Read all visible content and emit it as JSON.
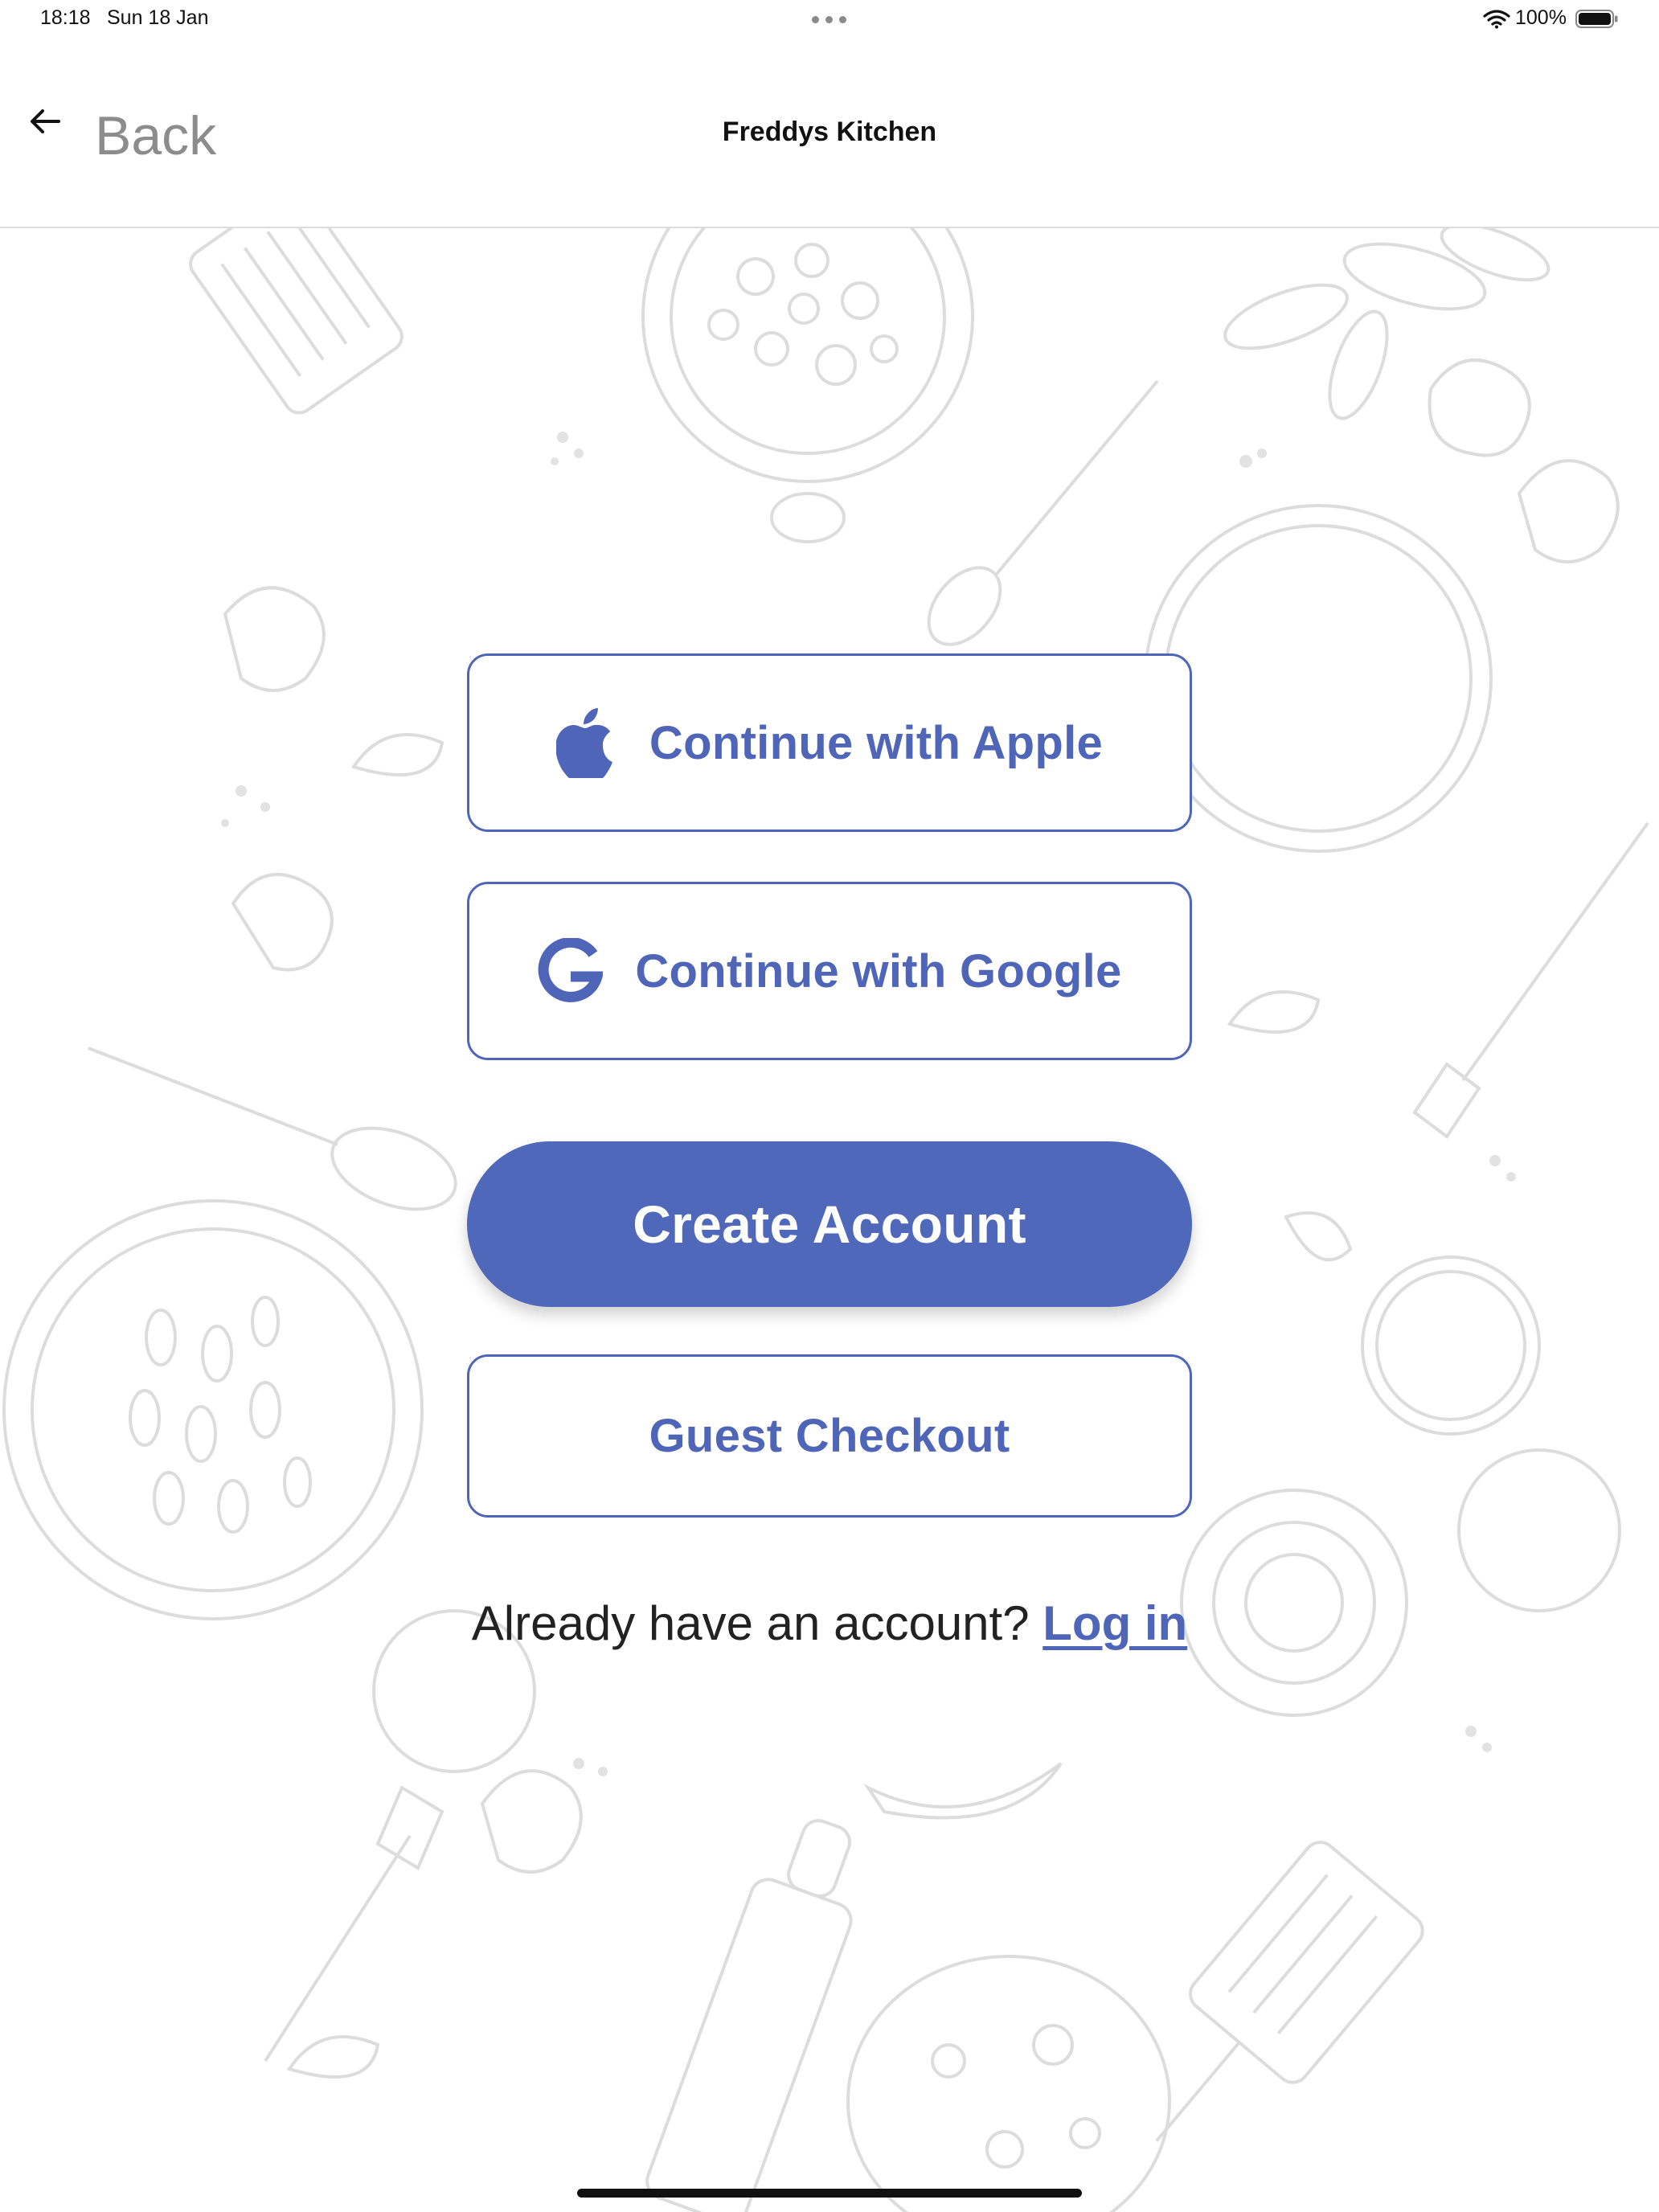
{
  "status_bar": {
    "time": "18:18",
    "date": "Sun 18 Jan",
    "battery_percent": "100%",
    "battery_level": 1.0,
    "icons": [
      "multitasking-dots-icon",
      "wifi-icon",
      "battery-icon"
    ]
  },
  "nav": {
    "back_label": "Back",
    "back_icon": "back-arrow-icon",
    "title": "Freddys Kitchen"
  },
  "auth": {
    "apple_label": "Continue with Apple",
    "apple_icon": "apple-logo-icon",
    "google_label": "Continue with Google",
    "google_icon": "google-logo-icon",
    "create_account_label": "Create Account",
    "guest_checkout_label": "Guest Checkout",
    "login_prompt": "Already have an account?",
    "login_link": "Log in"
  },
  "colors": {
    "accent": "#5068ba",
    "outline_text": "#4f66b8",
    "back_text": "#8c8c8c",
    "background": "#ffffff"
  }
}
